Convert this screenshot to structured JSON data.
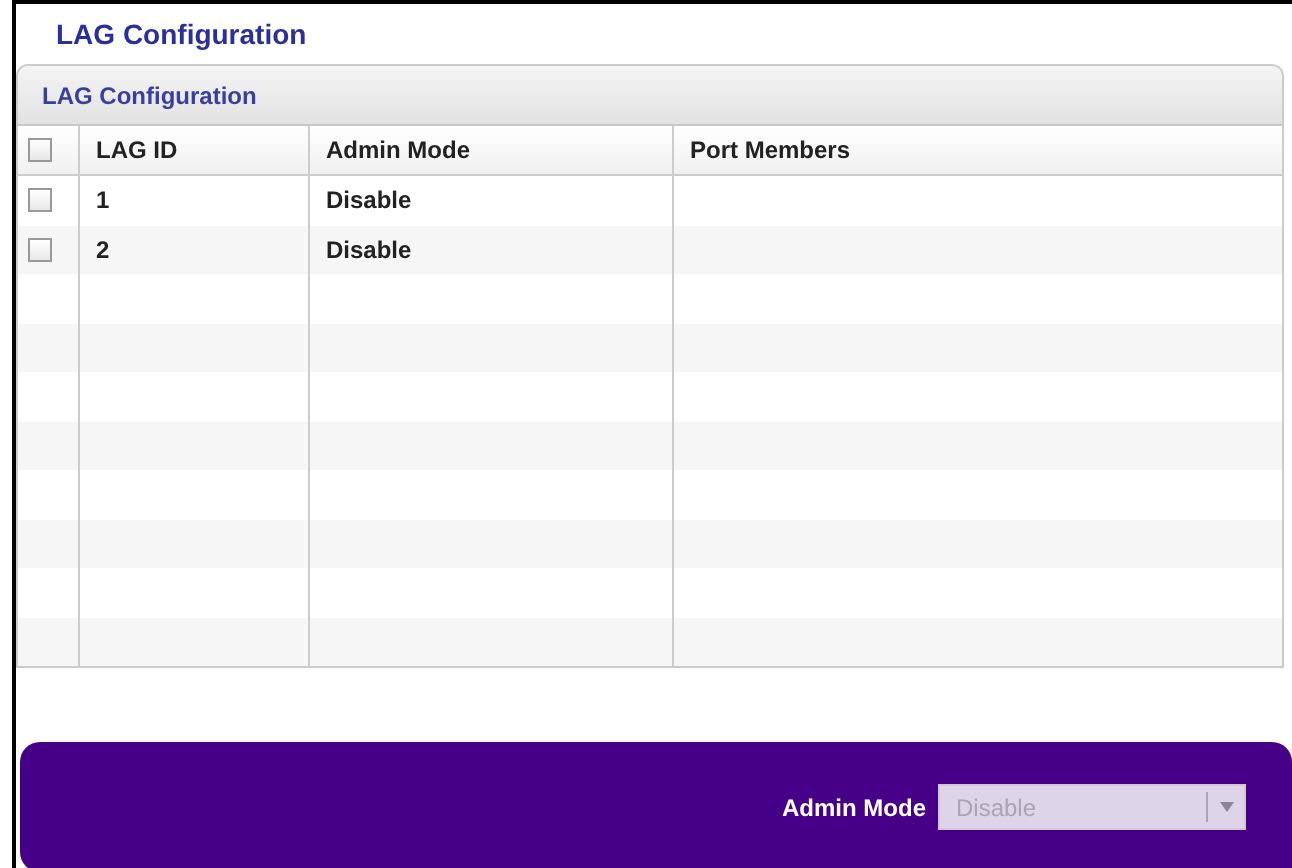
{
  "page_title": "LAG Configuration",
  "panel": {
    "title": "LAG Configuration",
    "table": {
      "select_all": {
        "checked": false
      },
      "columns": [
        "LAG ID",
        "Admin Mode",
        "Port Members"
      ],
      "rows": [
        {
          "selected": false,
          "cells": [
            "1",
            "Disable",
            ""
          ]
        },
        {
          "selected": false,
          "cells": [
            "2",
            "Disable",
            ""
          ]
        }
      ]
    }
  },
  "footer": {
    "label": "Admin Mode",
    "dropdown": {
      "value": "Disable",
      "disabled": true
    }
  }
}
